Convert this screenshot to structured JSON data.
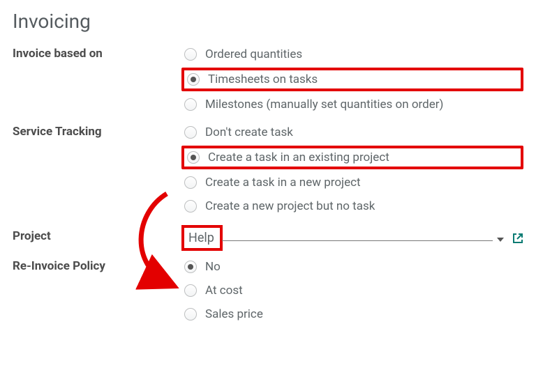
{
  "section": {
    "title": "Invoicing"
  },
  "invoice_based_on": {
    "label": "Invoice based on",
    "options": {
      "ordered": "Ordered quantities",
      "timesheets": "Timesheets on tasks",
      "milestones": "Milestones (manually set quantities on order)"
    },
    "selected": "timesheets"
  },
  "service_tracking": {
    "label": "Service Tracking",
    "options": {
      "no_task": "Don't create task",
      "existing_proj": "Create a task in an existing project",
      "new_proj": "Create a task in a new project",
      "proj_no_task": "Create a new project but no task"
    },
    "selected": "existing_proj"
  },
  "project": {
    "label": "Project",
    "value": "Help"
  },
  "reinvoice": {
    "label": "Re-Invoice Policy",
    "options": {
      "no": "No",
      "at_cost": "At cost",
      "sales_price": "Sales price"
    },
    "selected": "no"
  },
  "highlight_color": "#e30000",
  "accent_color": "#0a7b73"
}
